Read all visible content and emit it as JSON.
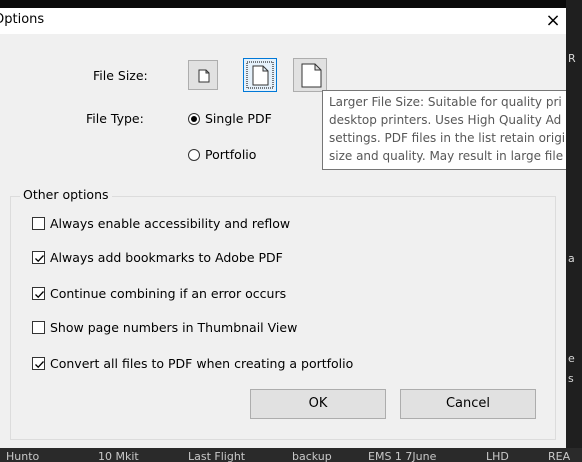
{
  "dialog": {
    "title": "Options",
    "close_glyph": "×"
  },
  "file_size": {
    "label": "File Size:",
    "options": [
      "small-file-icon",
      "default-file-icon",
      "large-file-icon"
    ],
    "selected_index": 1
  },
  "file_type": {
    "label": "File Type:",
    "options": [
      {
        "label": "Single PDF",
        "checked": true
      },
      {
        "label": "Portfolio",
        "checked": false
      }
    ]
  },
  "tooltip": {
    "lines": [
      "Larger File Size: Suitable for quality pri",
      "desktop printers. Uses High Quality Ad",
      "settings. PDF files in the list retain origi",
      "size and quality. May result in large file"
    ]
  },
  "other_options": {
    "legend": "Other options",
    "items": [
      {
        "label": "Always enable accessibility and reflow",
        "checked": false
      },
      {
        "label": "Always add bookmarks to Adobe PDF",
        "checked": true
      },
      {
        "label": "Continue combining if an error occurs",
        "checked": true
      },
      {
        "label": "Show page numbers in Thumbnail View",
        "checked": false
      },
      {
        "label": "Convert all files to PDF when creating a portfolio",
        "checked": true
      }
    ]
  },
  "buttons": {
    "ok": "OK",
    "cancel": "Cancel"
  },
  "background": {
    "right_chars": [
      "R",
      "a",
      "e",
      "s"
    ],
    "taskbar_items": [
      "Hunto",
      "10 Mkit",
      "Last Flight",
      "backup",
      "EMS 1 7June",
      "LHD",
      "REA"
    ]
  },
  "colors": {
    "accent": "#0078d7",
    "dialog_bg": "#f0f0f0"
  }
}
